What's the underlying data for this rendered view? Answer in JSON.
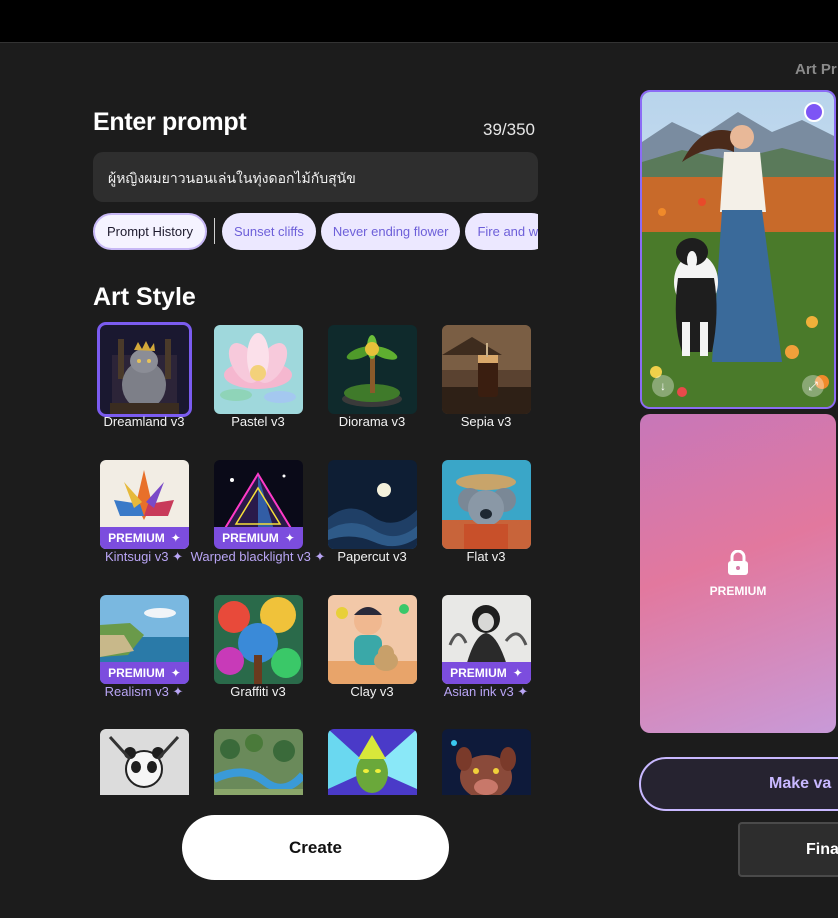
{
  "prompt": {
    "title": "Enter prompt",
    "count": "39/350",
    "text": "ผู้หญิงผมยาวนอนเล่นในทุ่งดอกไม้กับสุนัข"
  },
  "chips": {
    "history": "Prompt History",
    "items": [
      "Sunset cliffs",
      "Never ending flower",
      "Fire and w"
    ]
  },
  "art_style": {
    "title": "Art Style",
    "premium_label": "PREMIUM",
    "styles": [
      {
        "label": "Dreamland v3",
        "premium": false,
        "selected": true
      },
      {
        "label": "Pastel v3",
        "premium": false
      },
      {
        "label": "Diorama v3",
        "premium": false
      },
      {
        "label": "Sepia v3",
        "premium": false
      },
      {
        "label": "Kintsugi v3 ✦",
        "premium": true
      },
      {
        "label": "Warped blacklight v3 ✦",
        "premium": true
      },
      {
        "label": "Papercut v3",
        "premium": false
      },
      {
        "label": "Flat v3",
        "premium": false
      },
      {
        "label": "Realism v3 ✦",
        "premium": true
      },
      {
        "label": "Graffiti v3",
        "premium": false
      },
      {
        "label": "Clay v3",
        "premium": false
      },
      {
        "label": "Asian ink v3 ✦",
        "premium": true
      }
    ]
  },
  "create_label": "Create",
  "right": {
    "tab_label": "Art Pr",
    "locked_label": "PREMIUM",
    "make_variation_label": "Make va",
    "finalize_label": "Fina"
  },
  "colors": {
    "accent": "#7b5cf0",
    "premium": "#7c4dde",
    "background": "#1c1c1c"
  }
}
